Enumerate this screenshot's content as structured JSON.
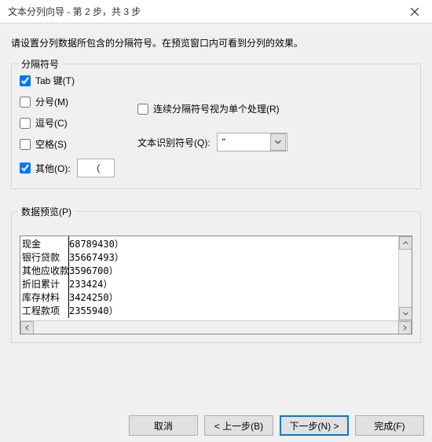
{
  "window": {
    "title": "文本分列向导 - 第 2 步，共 3 步"
  },
  "instruction": "请设置分列数据所包含的分隔符号。在预览窗口内可看到分列的效果。",
  "delimiters": {
    "legend": "分隔符号",
    "tab_label": "Tab 键(T)",
    "tab_checked": true,
    "semicolon_label": "分号(M)",
    "semicolon_checked": false,
    "comma_label": "逗号(C)",
    "comma_checked": false,
    "space_label": "空格(S)",
    "space_checked": false,
    "other_label": "其他(O):",
    "other_checked": true,
    "other_value": "（",
    "consecutive_label": "连续分隔符号视为单个处理(R)",
    "consecutive_checked": false,
    "qualifier_label": "文本识别符号(Q):",
    "qualifier_value": "\""
  },
  "preview": {
    "legend": "数据预览(P)",
    "rows": [
      {
        "c0": "现金",
        "c1": "68789430）"
      },
      {
        "c0": "银行贷款",
        "c1": "35667493）"
      },
      {
        "c0": "其他应收款",
        "c1": "3596700）"
      },
      {
        "c0": "折旧累计",
        "c1": "233424）"
      },
      {
        "c0": "库存材料",
        "c1": "3424250）"
      },
      {
        "c0": "工程款项",
        "c1": "2355940）"
      }
    ]
  },
  "buttons": {
    "cancel": "取消",
    "back": "< 上一步(B)",
    "next": "下一步(N) >",
    "finish": "完成(F)"
  }
}
